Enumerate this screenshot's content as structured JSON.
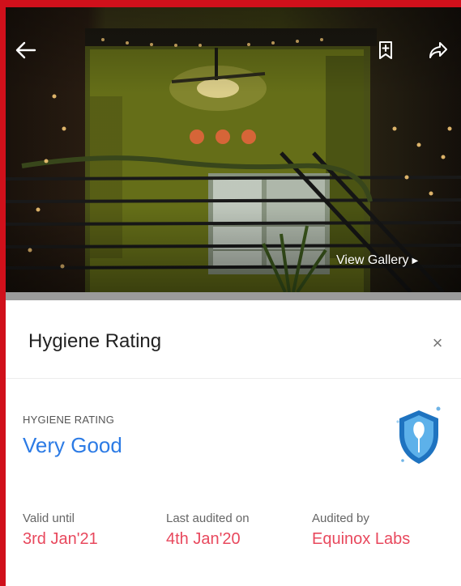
{
  "hero": {
    "gallery_label": "View Gallery"
  },
  "sheet": {
    "title": "Hygiene Rating",
    "close_label": "×"
  },
  "rating": {
    "label": "HYGIENE RATING",
    "value": "Very Good",
    "value_color": "#2c7be5"
  },
  "details": [
    {
      "label": "Valid until",
      "value": "3rd Jan'21"
    },
    {
      "label": "Last audited on",
      "value": "4th Jan'20"
    },
    {
      "label": "Audited by",
      "value": "Equinox Labs"
    }
  ],
  "colors": {
    "accent": "#e8485d",
    "frame": "#d0101b"
  },
  "icons": [
    "back-arrow-icon",
    "bookmark-icon",
    "share-icon",
    "chevron-right-icon",
    "close-icon",
    "hygiene-shield-icon"
  ]
}
